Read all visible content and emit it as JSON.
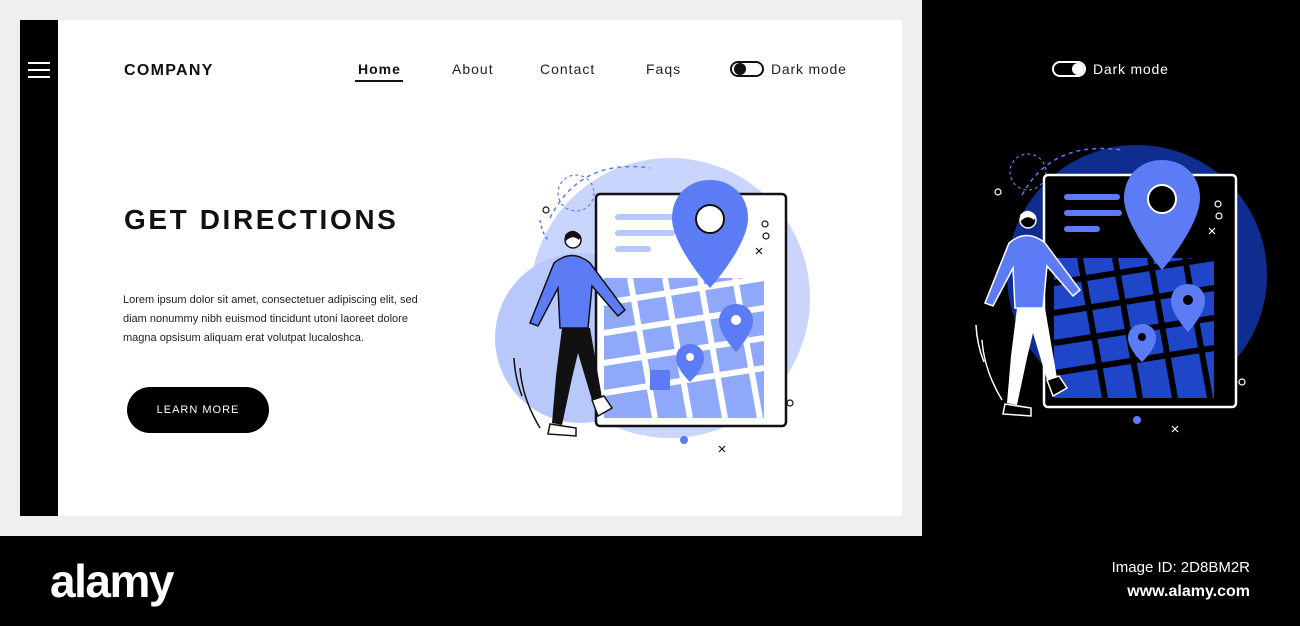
{
  "header": {
    "brand": "COMPANY",
    "nav": [
      "Home",
      "About",
      "Contact",
      "Faqs"
    ],
    "active_nav": "Home",
    "dark_mode_label": "Dark mode"
  },
  "hero": {
    "title": "GET DIRECTIONS",
    "body": "Lorem ipsum dolor sit amet, consectetuer adipiscing elit, sed diam nonummy nibh euismod tincidunt utoni laoreet dolore magna opsisum aliquam erat volutpat lucaloshca.",
    "cta_label": "LEARN MORE"
  },
  "dark_preview": {
    "dark_mode_label": "Dark mode"
  },
  "watermark": {
    "logo": "alamy",
    "image_id": "Image ID: 2D8BM2R",
    "url": "www.alamy.com"
  },
  "colors": {
    "accent": "#5b7cf5",
    "light_blue": "#b8c8fb",
    "dark_blob": "#0f2d8f",
    "black": "#000000",
    "white": "#ffffff"
  },
  "icons": [
    "hamburger-icon",
    "map-pin-icon",
    "toggle-icon"
  ]
}
